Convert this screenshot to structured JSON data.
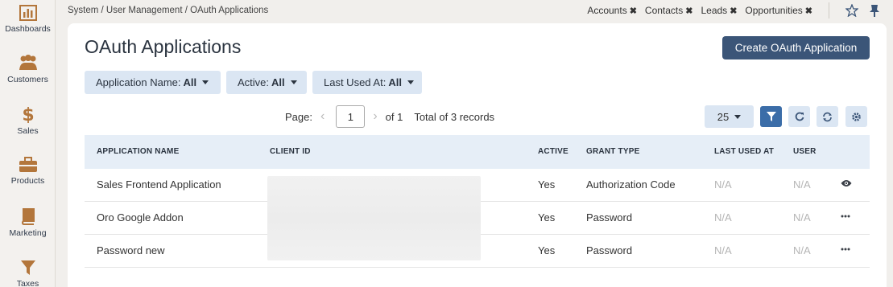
{
  "sidebar": {
    "items": [
      {
        "label": "Dashboards",
        "icon": "dashboards-icon"
      },
      {
        "label": "Customers",
        "icon": "customers-icon"
      },
      {
        "label": "Sales",
        "icon": "dollar-icon"
      },
      {
        "label": "Products",
        "icon": "briefcase-icon"
      },
      {
        "label": "Marketing",
        "icon": "book-icon"
      },
      {
        "label": "Taxes",
        "icon": "funnel-icon"
      }
    ],
    "icon_color": "#b3763b"
  },
  "breadcrumb": "System / User Management / OAuth Applications",
  "pinned": [
    {
      "label": "Accounts",
      "close": "✖"
    },
    {
      "label": "Contacts",
      "close": "✖"
    },
    {
      "label": "Leads",
      "close": "✖"
    },
    {
      "label": "Opportunities",
      "close": "✖"
    }
  ],
  "page": {
    "title": "OAuth Applications",
    "create_label": "Create OAuth Application"
  },
  "filters": [
    {
      "name": "Application Name:",
      "value": "All"
    },
    {
      "name": "Active:",
      "value": "All"
    },
    {
      "name": "Last Used At:",
      "value": "All"
    }
  ],
  "pager": {
    "page_label": "Page:",
    "current_page": "1",
    "of_label": "of 1",
    "total_label": "Total of 3 records",
    "per_page": "25"
  },
  "table": {
    "headers": [
      "APPLICATION NAME",
      "CLIENT ID",
      "ACTIVE",
      "GRANT TYPE",
      "LAST USED AT",
      "USER"
    ],
    "rows": [
      {
        "name": "Sales Frontend Application",
        "client_id": "",
        "active": "Yes",
        "grant_type": "Authorization Code",
        "last_used": "N/A",
        "user": "N/A",
        "action": "eye-icon"
      },
      {
        "name": "Oro Google Addon",
        "client_id": "",
        "active": "Yes",
        "grant_type": "Password",
        "last_used": "N/A",
        "user": "N/A",
        "action": "more-icon"
      },
      {
        "name": "Password new",
        "client_id": "",
        "active": "Yes",
        "grant_type": "Password",
        "last_used": "N/A",
        "user": "N/A",
        "action": "more-icon"
      }
    ]
  },
  "colors": {
    "primary_button": "#3b5578",
    "filter_bg": "#dbe6f3",
    "active_tool": "#3b6da8"
  }
}
